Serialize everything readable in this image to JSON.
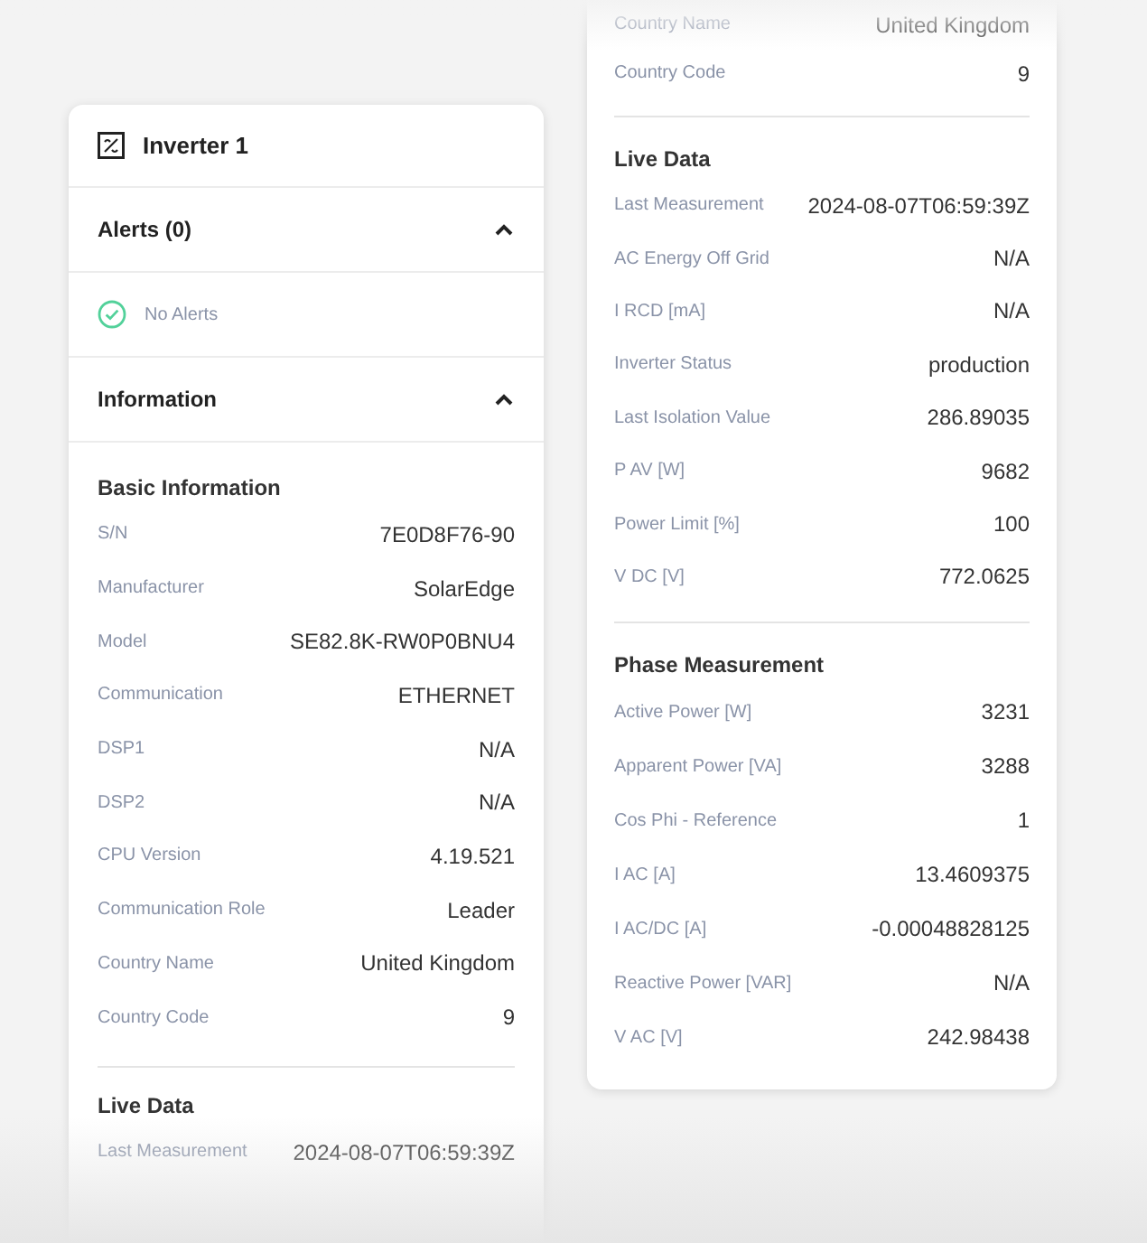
{
  "left_card": {
    "title": "Inverter 1",
    "alerts": {
      "title": "Alerts (0)",
      "expanded": true,
      "message": "No Alerts"
    },
    "information": {
      "title": "Information",
      "expanded": true,
      "groups": [
        {
          "title": "Basic Information",
          "rows": [
            {
              "label": "S/N",
              "value": "7E0D8F76-90"
            },
            {
              "label": "Manufacturer",
              "value": "SolarEdge"
            },
            {
              "label": "Model",
              "value": "SE82.8K-RW0P0BNU4"
            },
            {
              "label": "Communication",
              "value": "ETHERNET"
            },
            {
              "label": "DSP1",
              "value": "N/A"
            },
            {
              "label": "DSP2",
              "value": "N/A"
            },
            {
              "label": "CPU Version",
              "value": "4.19.521"
            },
            {
              "label": "Communication Role",
              "value": "Leader"
            },
            {
              "label": "Country Name",
              "value": "United Kingdom"
            },
            {
              "label": "Country Code",
              "value": "9"
            }
          ]
        },
        {
          "title": "Live Data",
          "rows": [
            {
              "label": "Last Measurement",
              "value": "2024-08-07T06:59:39Z"
            }
          ]
        }
      ]
    }
  },
  "right_card": {
    "top_rows": [
      {
        "label": "Country Name",
        "value": "United Kingdom"
      },
      {
        "label": "Country Code",
        "value": "9"
      }
    ],
    "groups": [
      {
        "title": "Live Data",
        "rows": [
          {
            "label": "Last Measurement",
            "value": "2024-08-07T06:59:39Z"
          },
          {
            "label": "AC Energy Off Grid",
            "value": "N/A"
          },
          {
            "label": "I RCD [mA]",
            "value": "N/A"
          },
          {
            "label": "Inverter Status",
            "value": "production"
          },
          {
            "label": "Last Isolation Value",
            "value": "286.89035"
          },
          {
            "label": "P AV [W]",
            "value": "9682"
          },
          {
            "label": "Power Limit [%]",
            "value": "100"
          },
          {
            "label": "V DC [V]",
            "value": "772.0625"
          }
        ]
      },
      {
        "title": "Phase Measurement",
        "rows": [
          {
            "label": "Active Power [W]",
            "value": "3231"
          },
          {
            "label": "Apparent Power [VA]",
            "value": "3288"
          },
          {
            "label": "Cos Phi - Reference",
            "value": "1"
          },
          {
            "label": "I AC [A]",
            "value": "13.4609375"
          },
          {
            "label": "I AC/DC [A]",
            "value": "-0.00048828125"
          },
          {
            "label": "Reactive Power [VAR]",
            "value": "N/A"
          },
          {
            "label": "V AC [V]",
            "value": "242.98438"
          }
        ]
      }
    ]
  }
}
